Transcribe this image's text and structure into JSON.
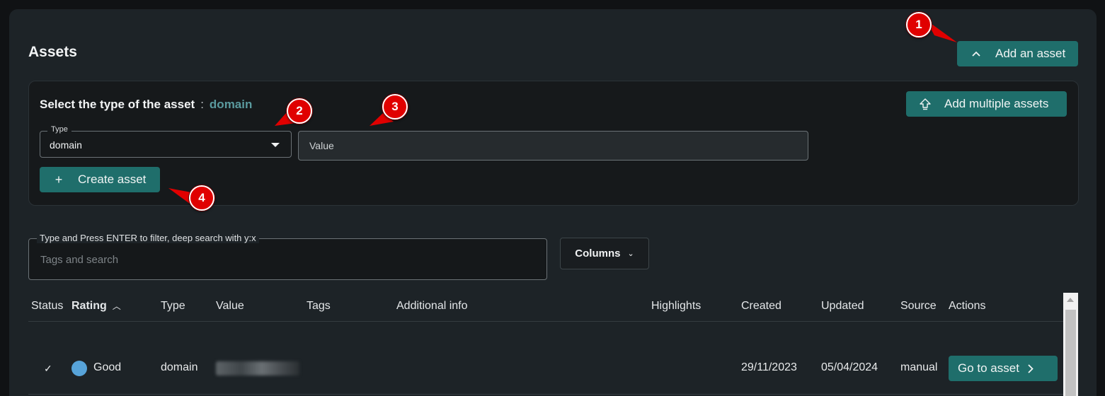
{
  "header": {
    "title": "Assets",
    "add_asset_label": "Add an asset",
    "add_asset_icon": "chevron-up-icon"
  },
  "create_panel": {
    "title": "Select the type of the asset",
    "separator": ":",
    "selected_type": "domain",
    "add_multiple_label": "Add multiple assets",
    "add_multiple_icon": "upload-arrow-icon",
    "type_field": {
      "label": "Type",
      "value": "domain"
    },
    "value_field": {
      "placeholder": "Value"
    },
    "create_label": "Create asset",
    "create_icon": "plus-icon"
  },
  "filter": {
    "label": "Type and Press ENTER to filter, deep search with y:x",
    "placeholder": "Tags and search",
    "columns_label": "Columns"
  },
  "table": {
    "columns": [
      "Status",
      "Rating",
      "Type",
      "Value",
      "Tags",
      "Additional info",
      "Highlights",
      "Created",
      "Updated",
      "Source",
      "Actions"
    ],
    "sorted_column": "Rating",
    "rows": [
      {
        "status_icon": "check-icon",
        "rating": "Good",
        "rating_color": "#57a3d9",
        "type": "domain",
        "value": "",
        "tags": "",
        "additional_info": "",
        "highlights": "",
        "created": "29/11/2023",
        "updated": "05/04/2024",
        "source": "manual",
        "action_label": "Go to asset"
      }
    ]
  },
  "annotations": [
    "1",
    "2",
    "3",
    "4"
  ],
  "colors": {
    "accent": "#1f6e6b",
    "marker": "#e00000",
    "background": "#1d2327"
  }
}
